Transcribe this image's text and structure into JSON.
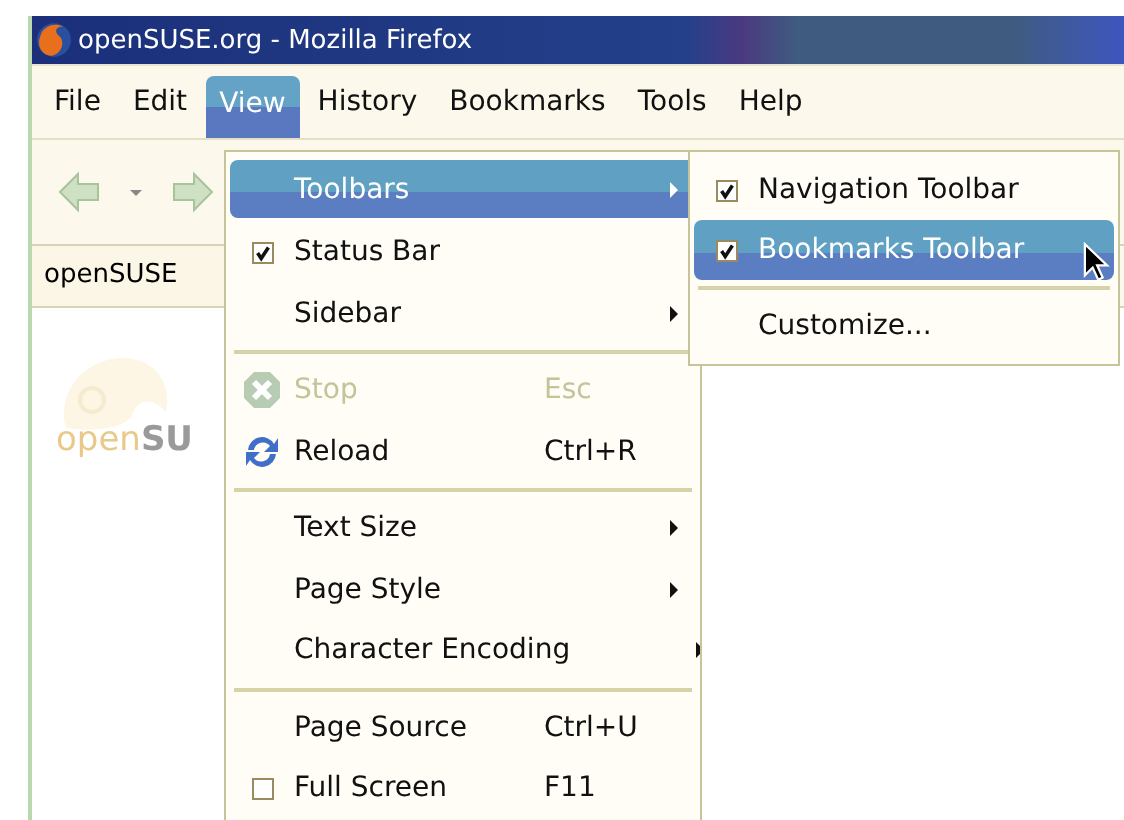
{
  "window": {
    "title": "openSUSE.org - Mozilla Firefox"
  },
  "menubar": [
    {
      "label": "File",
      "selected": false
    },
    {
      "label": "Edit",
      "selected": false
    },
    {
      "label": "View",
      "selected": true
    },
    {
      "label": "History",
      "selected": false
    },
    {
      "label": "Bookmarks",
      "selected": false
    },
    {
      "label": "Tools",
      "selected": false
    },
    {
      "label": "Help",
      "selected": false
    }
  ],
  "tab": {
    "label": "openSUSE"
  },
  "page": {
    "logo": "open**SU**"
  },
  "view_menu": [
    {
      "kind": "submenu",
      "label": "Toolbars",
      "selected": true
    },
    {
      "kind": "check",
      "label": "Status Bar",
      "checked": true,
      "selected": false
    },
    {
      "kind": "submenu",
      "label": "Sidebar",
      "selected": false
    },
    {
      "kind": "separator"
    },
    {
      "kind": "command",
      "label": "Stop",
      "shortcut": "Esc",
      "disabled": true,
      "selected": false
    },
    {
      "kind": "command",
      "label": "Reload",
      "shortcut": "Ctrl+R",
      "disabled": false,
      "selected": false
    },
    {
      "kind": "separator"
    },
    {
      "kind": "submenu",
      "label": "Text Size",
      "selected": false
    },
    {
      "kind": "submenu",
      "label": "Page Style",
      "selected": false
    },
    {
      "kind": "submenu",
      "label": "Character Encoding",
      "selected": false
    },
    {
      "kind": "separator"
    },
    {
      "kind": "command",
      "label": "Page Source",
      "shortcut": "Ctrl+U",
      "disabled": false,
      "selected": false
    },
    {
      "kind": "check",
      "label": "Full Screen",
      "shortcut": "F11",
      "checked": false,
      "selected": false
    }
  ],
  "toolbars_menu": [
    {
      "kind": "check",
      "label": "Navigation Toolbar",
      "checked": true,
      "selected": false
    },
    {
      "kind": "check",
      "label": "Bookmarks Toolbar",
      "checked": true,
      "selected": true
    },
    {
      "kind": "separator"
    },
    {
      "kind": "command",
      "label": "Customize...",
      "selected": false
    }
  ]
}
